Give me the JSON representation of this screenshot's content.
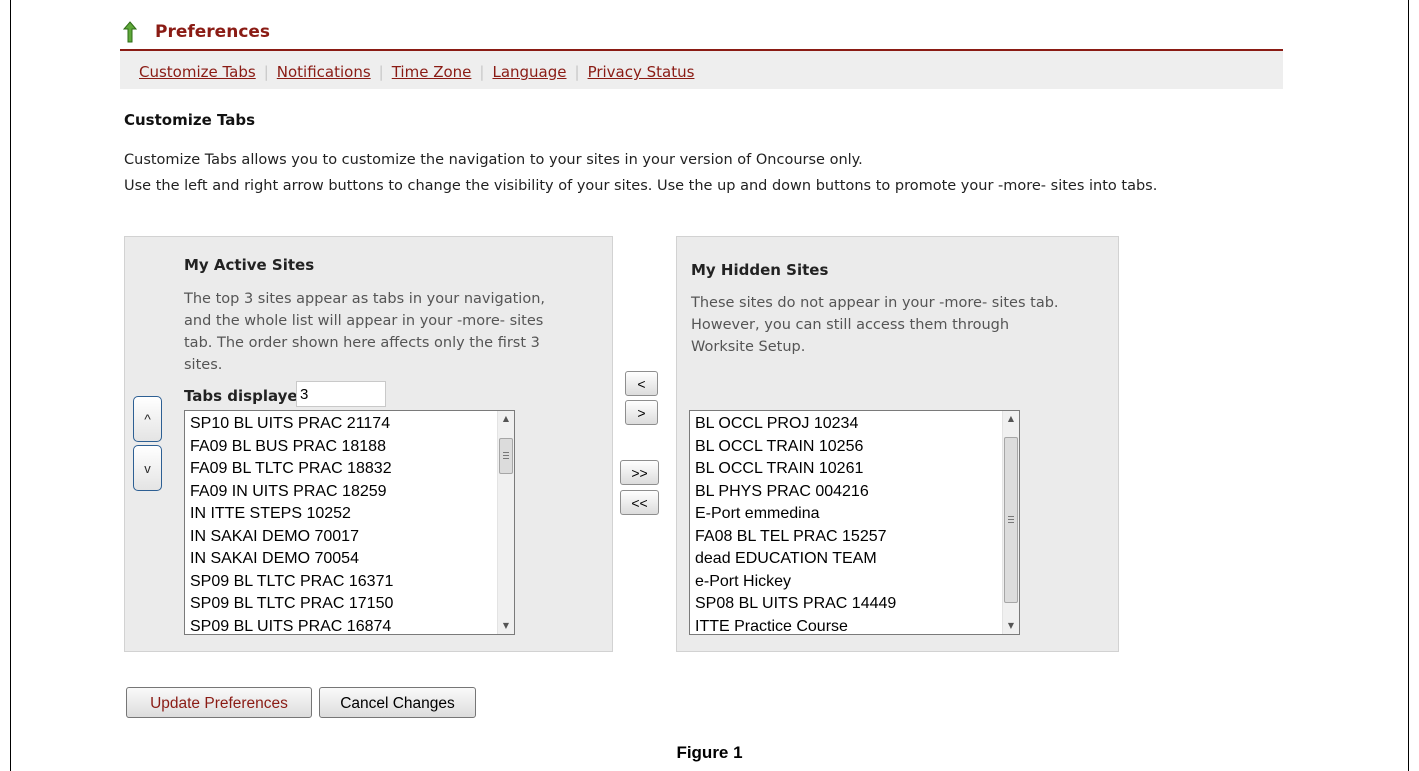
{
  "colors": {
    "accent": "#8a1b14",
    "panel": "#ebebeb",
    "nav_bg": "#eeeeee"
  },
  "header": {
    "title": "Preferences",
    "icon": "up-arrow-icon"
  },
  "nav": {
    "links": [
      "Customize Tabs",
      "Notifications",
      "Time Zone",
      "Language",
      "Privacy Status"
    ],
    "separator": "|"
  },
  "section": {
    "title": "Customize Tabs",
    "intro": [
      "Customize Tabs allows you to customize the navigation to your sites in your version of Oncourse only.",
      "Use the left and right arrow buttons to change the visibility of your sites. Use the up and down buttons to promote your -more- sites into tabs."
    ]
  },
  "active": {
    "title": "My Active Sites",
    "desc": [
      "The top 3 sites appear as tabs in your navigation,",
      "and the whole list will appear in your -more- sites",
      "tab. The order shown here affects only the first 3",
      "sites."
    ],
    "tabs_label": "Tabs displayed:",
    "tabs_value": "3",
    "sites": [
      "SP10 BL UITS PRAC 21174",
      "FA09 BL BUS PRAC 18188",
      "FA09 BL TLTC PRAC 18832",
      "FA09 IN UITS PRAC 18259",
      "IN ITTE STEPS 10252",
      "IN SAKAI DEMO 70017",
      "IN SAKAI DEMO 70054",
      "SP09 BL TLTC PRAC 16371",
      "SP09 BL TLTC PRAC 17150",
      "SP09 BL UITS PRAC 16874"
    ],
    "move_up": "^",
    "move_down": "v"
  },
  "hidden": {
    "title": "My Hidden Sites",
    "desc": [
      "These sites do not appear in your -more- sites tab.",
      "However, you can still access them through",
      "Worksite Setup."
    ],
    "sites": [
      "BL OCCL PROJ 10234",
      "BL OCCL TRAIN 10256",
      "BL OCCL TRAIN 10261",
      "BL PHYS PRAC 004216",
      "E-Port emmedina",
      "FA08 BL TEL PRAC 15257",
      "dead EDUCATION TEAM",
      "e-Port Hickey",
      "SP08 BL UITS PRAC 14449",
      "ITTE Practice Course"
    ]
  },
  "transfer": {
    "show_one": "<",
    "hide_one": ">",
    "hide_all": ">>",
    "show_all": "<<"
  },
  "actions": {
    "update": "Update Preferences",
    "cancel": "Cancel Changes"
  },
  "caption": "Figure 1"
}
